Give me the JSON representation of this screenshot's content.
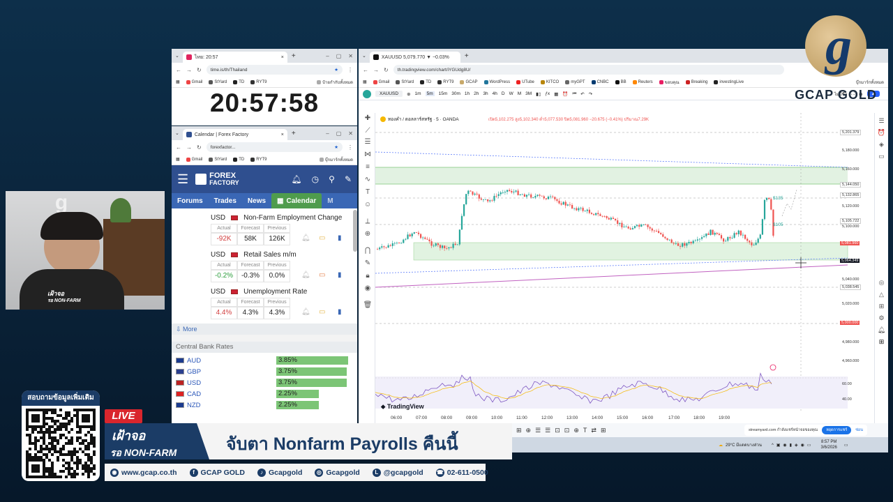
{
  "clock_window": {
    "tab_title": "ไทย: 20:57",
    "url": "time.is/th/Thailand",
    "bookmarks": [
      "Gmail",
      "StYard",
      "TD",
      "RYT9",
      "ป้ายกำกับทั้งหมด"
    ],
    "time": "20:57:58"
  },
  "forex_window": {
    "tab_title": "Calendar | Forex Factory",
    "url": "forexfactor...",
    "bookmarks": [
      "Gmail",
      "StYard",
      "TD",
      "RYT9",
      "บุ๊กมาร์กทั้งหมด"
    ],
    "brand_line1": "FOREX",
    "brand_line2": "FACTORY",
    "nav": [
      "Forums",
      "Trades",
      "News",
      "Calendar",
      "M"
    ],
    "events": [
      {
        "currency": "USD",
        "name": "Non-Farm Employment Change",
        "actual": "-92K",
        "forecast": "58K",
        "previous": "126K",
        "actual_color": "#d23f3f"
      },
      {
        "currency": "USD",
        "name": "Retail Sales m/m",
        "actual": "-0.2%",
        "forecast": "-0.3%",
        "previous": "0.0%",
        "actual_color": "#2e9e3e"
      },
      {
        "currency": "USD",
        "name": "Unemployment Rate",
        "actual": "4.4%",
        "forecast": "4.3%",
        "previous": "4.3%",
        "actual_color": "#d23f3f"
      }
    ],
    "col_headers": [
      "Actual",
      "Forecast",
      "Previous"
    ],
    "more_label": "More",
    "cb_title": "Central Bank Rates",
    "rates": [
      {
        "ccy": "AUD",
        "rate": "3.85%",
        "bar": 0.95
      },
      {
        "ccy": "GBP",
        "rate": "3.75%",
        "bar": 0.93
      },
      {
        "ccy": "USD",
        "rate": "3.75%",
        "bar": 0.93
      },
      {
        "ccy": "CAD",
        "rate": "2.25%",
        "bar": 0.56
      },
      {
        "ccy": "NZD",
        "rate": "2.25%",
        "bar": 0.56
      }
    ]
  },
  "tv_window": {
    "tab_title": "XAUUSD 5,079.770 ▼ −0.03%",
    "url": "th.tradingview.com/chart/iYGUdg8U/",
    "bookmarks": [
      "Gmail",
      "StYard",
      "TD",
      "RYT9",
      "GCAP",
      "WordPress",
      "UTube",
      "KITCO",
      "myGPT",
      "CNBC",
      "BB",
      "Reuters",
      "ขอบคุณ",
      "Breaking",
      "investingLive"
    ],
    "bookmarks_right": "บุ๊กมาร์กทั้งหมด",
    "symbol": "XAUUSD",
    "intervals": [
      "1m",
      "5m",
      "15m",
      "30m",
      "1h",
      "2h",
      "3h",
      "4h",
      "D",
      "W",
      "M",
      "3M"
    ],
    "right_label": "ไม่มีชื่อ",
    "legend": "ทองคำ / ดอลลาร์สหรัฐ · 5 · OANDA",
    "ohlc": "เปิด5,102.275 สูง5,102.340 ต่ำ5,077.530 ปิด5,081.960 −20.675 (−0.41%) ปริมาณ7.29K",
    "price_labels": [
      "5,201.379",
      "5,180.000",
      "5,160.000",
      "5,144.050",
      "5,132.865",
      "5,120.000",
      "5,105.722",
      "5,100.000",
      "5,081.960",
      "5,064.349",
      "5,040.000",
      "5,038.545",
      "5,020.000",
      "5,000.000",
      "4,980.000",
      "4,960.000"
    ],
    "annotations": [
      "$135",
      "$105"
    ],
    "osc_labels": [
      "60.00",
      "40.00"
    ],
    "time_labels": [
      "06:00",
      "07:00",
      "08:00",
      "09:00",
      "10:00",
      "11:00",
      "12:00",
      "13:00",
      "14:00",
      "15:00",
      "16:00",
      "17:00",
      "18:00",
      "19:00"
    ],
    "watermark": "TradingView",
    "notification": "streamyard.com กำลังแชร์หน้าจอของคุณ",
    "share_btn": "หยุดการแชร์",
    "hide_btn": "ซ่อน",
    "weather": "29°C มีแดดบางส่วน",
    "clock_time": "8:57 PM",
    "clock_date": "3/6/2026"
  },
  "brand": {
    "logo_letter": "g",
    "name": "GCAP GOLD"
  },
  "qr": {
    "title": "สอบถามข้อมูลเพิ่มเติม"
  },
  "lower_third": {
    "live": "LIVE",
    "tag_line1": "เฝ้าจอ",
    "tag_line2": "รอ NON-FARM",
    "headline": "จับตา Nonfarm Payrolls คืนนี้",
    "footer": [
      "www.gcap.co.th",
      "GCAP GOLD",
      "Gcapgold",
      "Gcapgold",
      "@gcapgold",
      "02-611-0500"
    ]
  },
  "presenter": {
    "shirt_text_1": "เฝ้าจอ",
    "shirt_text_2": "รอ NON-FARM"
  },
  "colors": {
    "tv_green": "#26a69a",
    "tv_red": "#ef5350",
    "ff_blue": "#2f4f8f",
    "brand_gold": "#c8a96a"
  }
}
